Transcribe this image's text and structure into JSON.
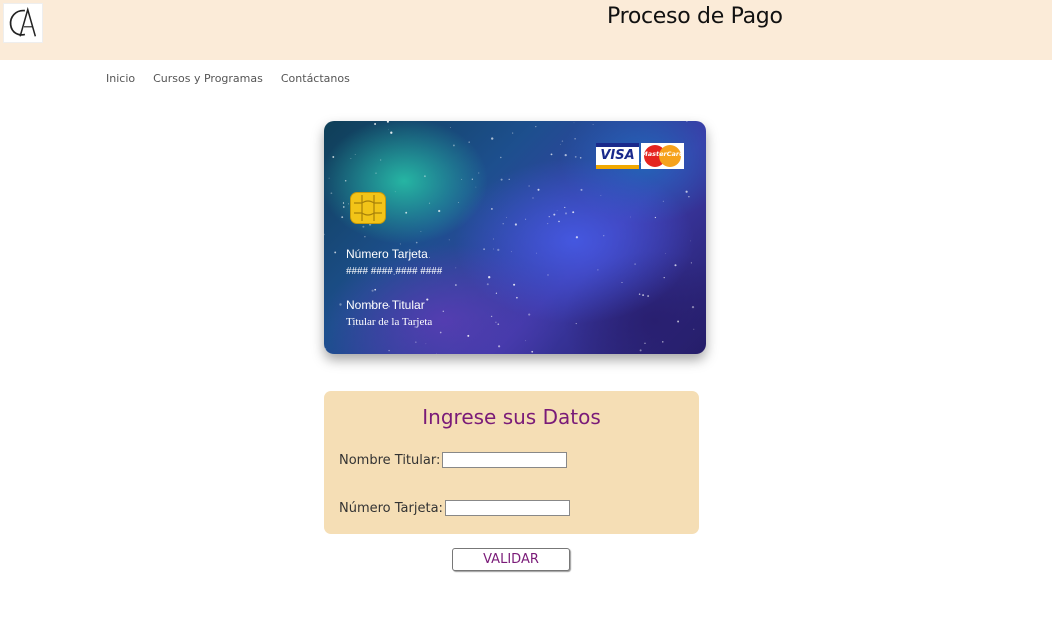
{
  "header": {
    "title": "Proceso de Pago",
    "logo_icon": "ca-monogram-icon"
  },
  "nav": {
    "items": [
      "Inicio",
      "Cursos y Programas",
      "Contáctanos"
    ]
  },
  "card": {
    "brands": {
      "visa": "VISA",
      "mastercard": "MasterCard"
    },
    "number_label": "Número Tarjeta",
    "number_value": "#### #### #### ####",
    "holder_label": "Nombre Titular",
    "holder_value": "Titular de la Tarjeta"
  },
  "form": {
    "title": "Ingrese sus Datos",
    "holder_label": "Nombre Titular:",
    "holder_value": "",
    "number_label": "Número Tarjeta:",
    "number_value": ""
  },
  "actions": {
    "validate_label": "VALIDAR"
  },
  "colors": {
    "header_bg": "#fbebd8",
    "form_bg": "#f5deb5",
    "accent": "#7a1b78"
  }
}
